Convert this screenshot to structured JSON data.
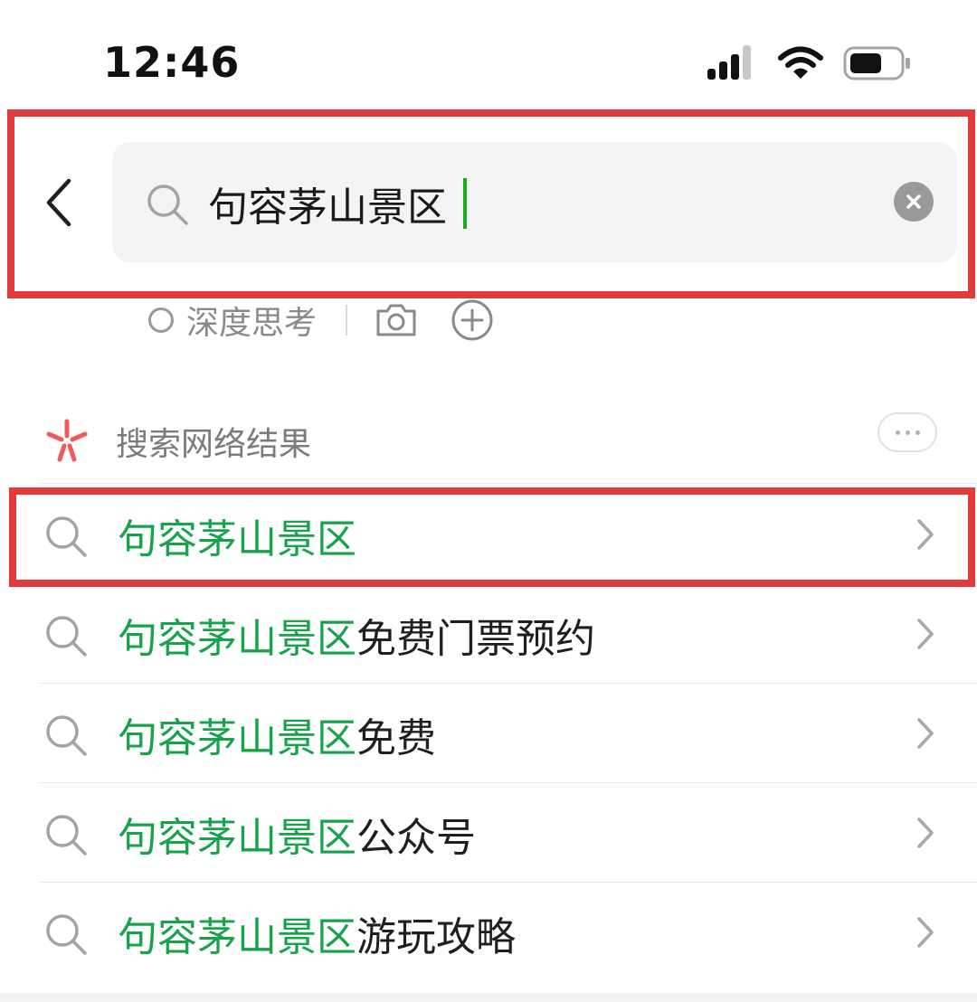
{
  "status_bar": {
    "time": "12:46"
  },
  "search": {
    "value": "句容茅山景区"
  },
  "tools": {
    "deep_think_label": "深度思考"
  },
  "section": {
    "title": "搜索网络结果"
  },
  "results": [
    {
      "highlight": "句容茅山景区",
      "rest": ""
    },
    {
      "highlight": "句容茅山景区",
      "rest": "免费门票预约"
    },
    {
      "highlight": "句容茅山景区",
      "rest": "免费"
    },
    {
      "highlight": "句容茅山景区",
      "rest": "公众号"
    },
    {
      "highlight": "句容茅山景区",
      "rest": "游玩攻略"
    }
  ],
  "colors": {
    "accent_green": "#17a34a",
    "annotation_red": "#e23b3b",
    "search_bg": "#f4f4f4"
  }
}
